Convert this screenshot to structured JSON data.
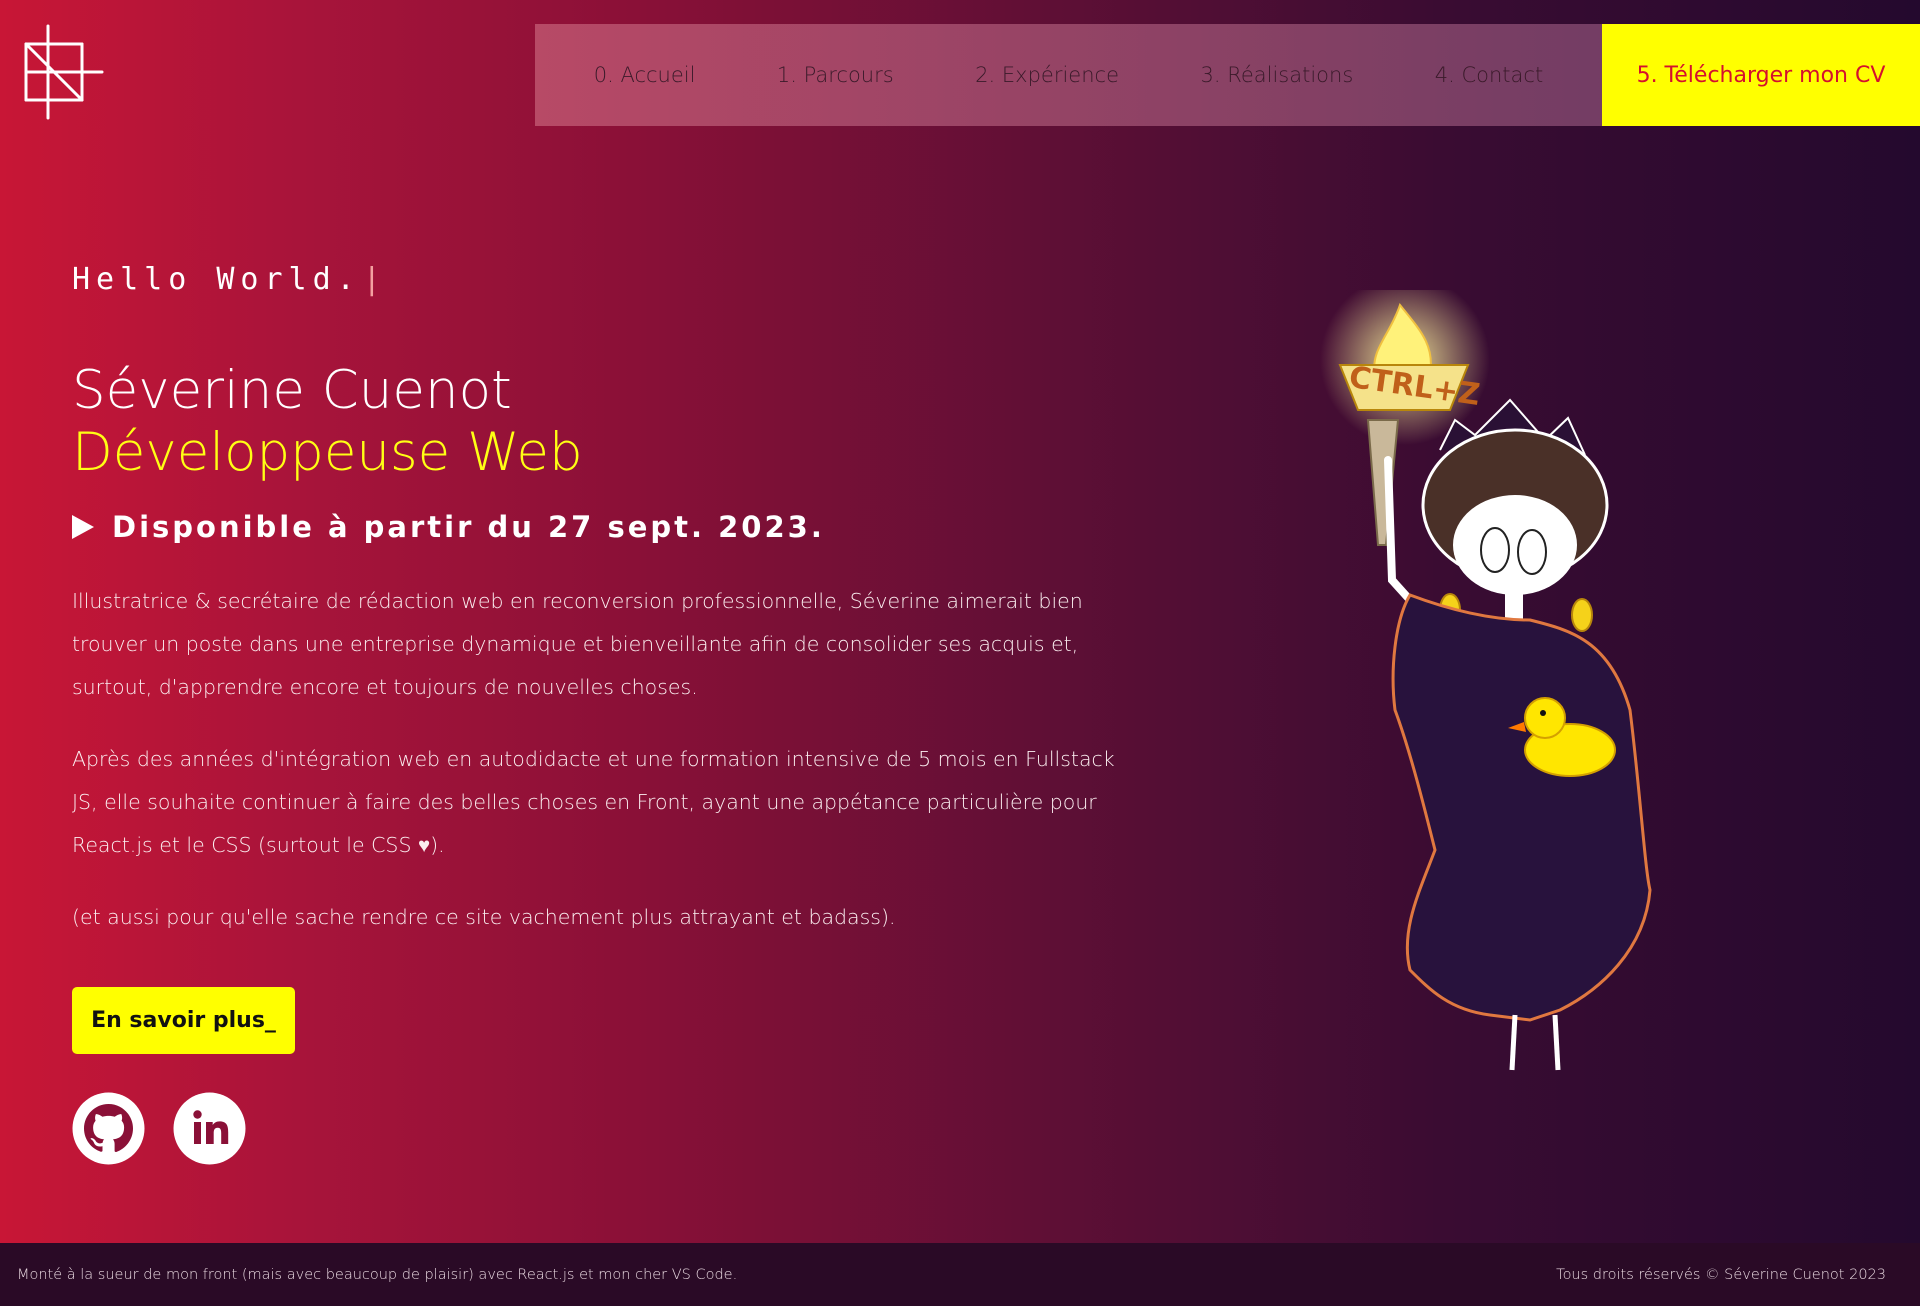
{
  "nav": {
    "items": [
      {
        "label": "0. Accueil"
      },
      {
        "label": "1. Parcours"
      },
      {
        "label": "2. Expérience"
      },
      {
        "label": "3. Réalisations"
      },
      {
        "label": "4. Contact"
      }
    ],
    "cv_label": "5. Télécharger mon CV"
  },
  "hero": {
    "hello": "Hello World.",
    "name": "Séverine Cuenot",
    "role": "Développeuse Web",
    "availability": "Disponible à partir du 27 sept. 2023.",
    "paragraphs": [
      "Illustratrice & secrétaire de rédaction web en reconversion professionnelle, Séverine aimerait bien trouver un poste dans une entreprise dynamique et bienveillante afin de consolider ses acquis et, surtout, d'apprendre encore et toujours de nouvelles choses.",
      "Après des années d'intégration web en autodidacte et une formation intensive de 5 mois en Fullstack JS, elle souhaite continuer à faire des belles choses en Front, ayant une appétance particulière pour React.js et le CSS (surtout le CSS ♥).",
      "(et aussi pour qu'elle sache rendre ce site vachement plus attrayant et badass)."
    ],
    "more_button": "En savoir plus_",
    "torch_text": "CTRL+Z"
  },
  "colors": {
    "accent": "#ffff00",
    "cv_text": "#d4102e",
    "gradient_start": "#c81636",
    "gradient_end": "#24092e"
  },
  "icons": {
    "github": "github-icon",
    "linkedin": "linkedin-icon"
  },
  "footer": {
    "left": "Monté à la sueur de mon front (mais avec beaucoup de plaisir) avec React.js et mon cher VS Code.",
    "right": "Tous droits réservés © Séverine Cuenot 2023"
  }
}
